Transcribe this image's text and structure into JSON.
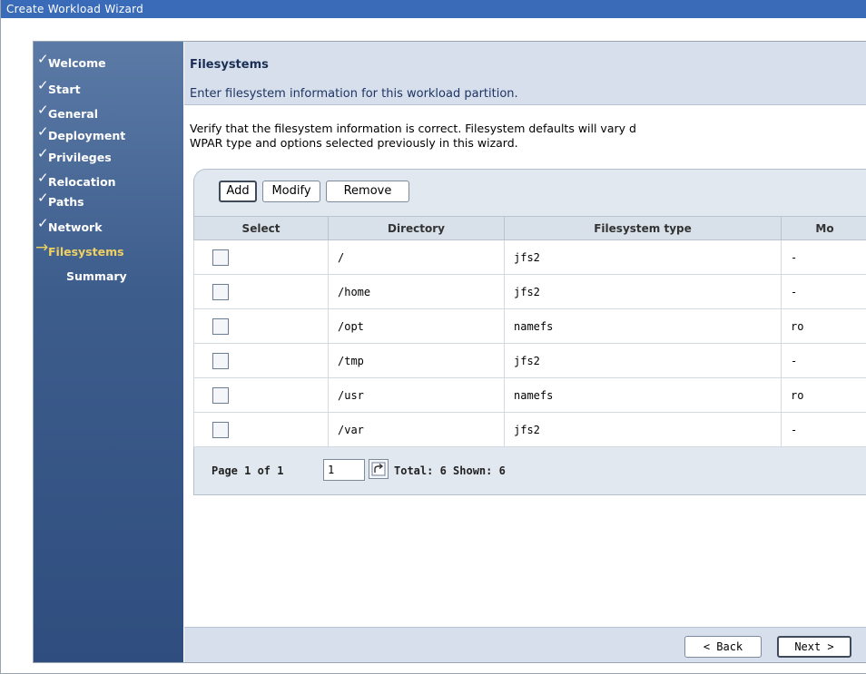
{
  "window": {
    "title": "Create Workload Wizard"
  },
  "nav": {
    "items": [
      {
        "label": "Welcome",
        "state": "done"
      },
      {
        "label": "Start",
        "state": "done"
      },
      {
        "label": "General",
        "state": "done"
      },
      {
        "label": "Deployment",
        "state": "done"
      },
      {
        "label": "Privileges",
        "state": "done"
      },
      {
        "label": "Relocation",
        "state": "done"
      },
      {
        "label": "Paths",
        "state": "done"
      },
      {
        "label": "Network",
        "state": "done"
      },
      {
        "label": "Filesystems",
        "state": "current"
      },
      {
        "label": "Summary",
        "state": "pending"
      }
    ],
    "done_mark": "✓",
    "current_mark": "→"
  },
  "content": {
    "title": "Filesystems",
    "subtitle": "Enter filesystem information for this workload partition.",
    "verify_line1": "Verify that the filesystem information is correct. Filesystem defaults will vary d",
    "verify_line2": "WPAR type and options selected previously in this wizard."
  },
  "toolbar": {
    "add_label": "Add",
    "modify_label": "Modify",
    "remove_label": "Remove"
  },
  "table": {
    "columns": [
      "Select",
      "Directory",
      "Filesystem type",
      "Mo"
    ],
    "rows": [
      {
        "directory": "/",
        "type": "jfs2",
        "mode": "-"
      },
      {
        "directory": "/home",
        "type": "jfs2",
        "mode": "-"
      },
      {
        "directory": "/opt",
        "type": "namefs",
        "mode": "ro"
      },
      {
        "directory": "/tmp",
        "type": "jfs2",
        "mode": "-"
      },
      {
        "directory": "/usr",
        "type": "namefs",
        "mode": "ro"
      },
      {
        "directory": "/var",
        "type": "jfs2",
        "mode": "-"
      }
    ]
  },
  "pager": {
    "label": "Page 1 of 1",
    "page_value": "1",
    "totals": "Total: 6 Shown: 6"
  },
  "footer": {
    "back_label": "< Back",
    "next_label": "Next >"
  }
}
